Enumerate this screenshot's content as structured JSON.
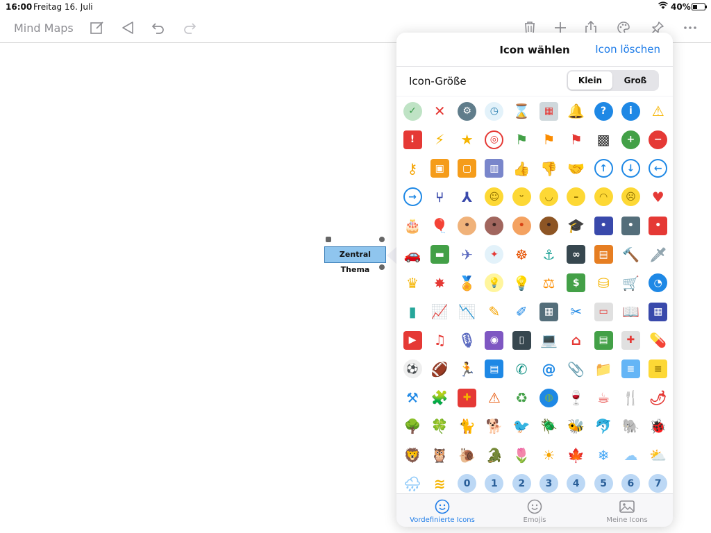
{
  "statusbar": {
    "time": "16:00",
    "date": "Freitag 16. Juli",
    "battery_percent": "40%",
    "battery_level": 0.4
  },
  "toolbar": {
    "title": "Mind Maps",
    "icons": [
      "compose-icon",
      "send-icon",
      "undo-icon",
      "redo-icon",
      "trash-icon",
      "plus-icon",
      "share-icon",
      "palette-icon",
      "pin-icon",
      "more-icon"
    ]
  },
  "canvas": {
    "node_label": "Zentral Thema"
  },
  "popover": {
    "title": "Icon wählen",
    "clear_button": "Icon löschen",
    "size_label": "Icon-Größe",
    "size_options": [
      "Klein",
      "Groß"
    ],
    "size_selected": "Klein",
    "number_icons": [
      "0",
      "1",
      "2",
      "3",
      "4",
      "5",
      "6",
      "7"
    ],
    "tabs": [
      "Vordefinierte Icons",
      "Emojis",
      "Meine Icons"
    ],
    "active_tab": "Vordefinierte Icons"
  },
  "colors": {
    "accent": "#1e7ce8",
    "node_fill": "#8fc5ee",
    "node_border": "#3c7fb8",
    "popover_bg": "#f2f2f7"
  }
}
